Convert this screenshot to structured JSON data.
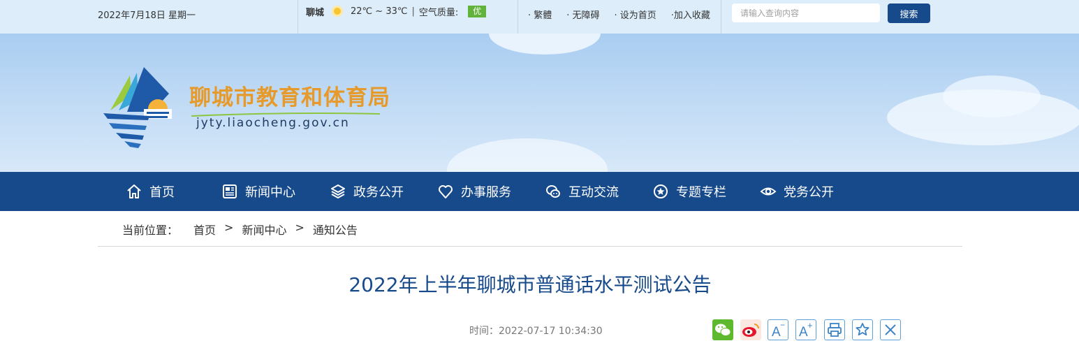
{
  "topbar": {
    "date": "2022年7月18日 星期一",
    "weather": {
      "city": "聊城",
      "icon": "sun-icon",
      "temperature": "22℃ ~ 33℃",
      "divider": "|",
      "air_quality_label": "空气质量:",
      "air_quality_value": "优",
      "air_quality_color": "#62b33b"
    },
    "links": [
      "· 繁體",
      "· 无障碍",
      "· 设为首页",
      "·加入收藏"
    ],
    "search": {
      "placeholder": "请输入查询内容",
      "button_label": "搜索"
    }
  },
  "banner": {
    "title": "聊城市教育和体育局",
    "url": "jyty.liaocheng.gov.cn"
  },
  "nav": {
    "items": [
      {
        "label": "首页",
        "icon": "home-icon"
      },
      {
        "label": "新闻中心",
        "icon": "newspaper-icon"
      },
      {
        "label": "政务公开",
        "icon": "layers-icon"
      },
      {
        "label": "办事服务",
        "icon": "heart-icon"
      },
      {
        "label": "互动交流",
        "icon": "chat-icon"
      },
      {
        "label": "专题专栏",
        "icon": "star-circle-icon"
      },
      {
        "label": "党务公开",
        "icon": "eye-icon"
      }
    ]
  },
  "breadcrumb": {
    "label": "当前位置：",
    "items": [
      "首页",
      "新闻中心",
      "通知公告"
    ],
    "separator": ">"
  },
  "article": {
    "title": "2022年上半年聊城市普通话水平测试公告",
    "time_label": "时间：",
    "time": "2022-07-17 10:34:30"
  },
  "share": {
    "icons": [
      "wechat-icon",
      "weibo-icon",
      "font-decrease-icon",
      "font-increase-icon",
      "print-icon",
      "favorite-icon",
      "close-icon"
    ],
    "font_decrease_text": "A",
    "font_increase_text": "A",
    "minus": "−",
    "plus": "+"
  },
  "colors": {
    "primary": "#174a8b",
    "title_orange": "#e79a2c",
    "topbar_bg": "#ddeefa"
  }
}
